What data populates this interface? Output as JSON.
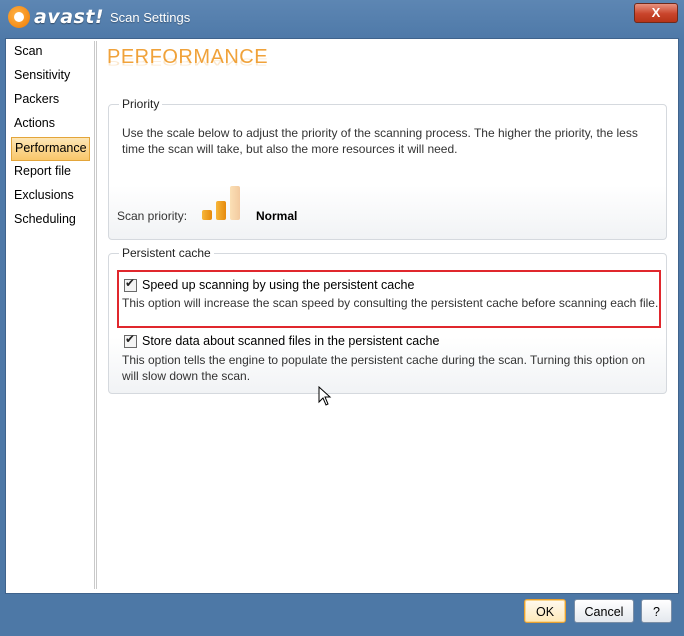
{
  "window": {
    "brand": "avast!",
    "title": "Scan Settings",
    "close_label": "X"
  },
  "sidebar": {
    "items": [
      {
        "label": "Scan"
      },
      {
        "label": "Sensitivity"
      },
      {
        "label": "Packers"
      },
      {
        "label": "Actions"
      },
      {
        "label": "Performance",
        "active": true
      },
      {
        "label": "Report file"
      },
      {
        "label": "Exclusions"
      },
      {
        "label": "Scheduling"
      }
    ]
  },
  "page": {
    "title": "PERFORMANCE"
  },
  "priority": {
    "group_label": "Priority",
    "description": "Use the scale below to adjust the priority of the scanning process. The higher the priority, the less time the scan will take, but also the more resources it will need.",
    "scan_priority_label": "Scan priority:",
    "scan_priority_value": "Normal",
    "level": 2,
    "level_max": 3
  },
  "cache": {
    "group_label": "Persistent cache",
    "options": [
      {
        "label": "Speed up scanning by using the persistent cache",
        "description": "This option will increase the scan speed by consulting the persistent cache before scanning each file.",
        "checked": true
      },
      {
        "label": "Store data about scanned files in the persistent cache",
        "description": "This option tells the engine to populate the persistent cache during the scan. Turning this option on will slow down the scan.",
        "checked": true
      }
    ]
  },
  "footer": {
    "ok_label": "OK",
    "cancel_label": "Cancel",
    "help_label": "?"
  },
  "colors": {
    "accent": "#f0a23a",
    "highlight_border": "#e0272d",
    "titlebar": "#5d86b3"
  }
}
